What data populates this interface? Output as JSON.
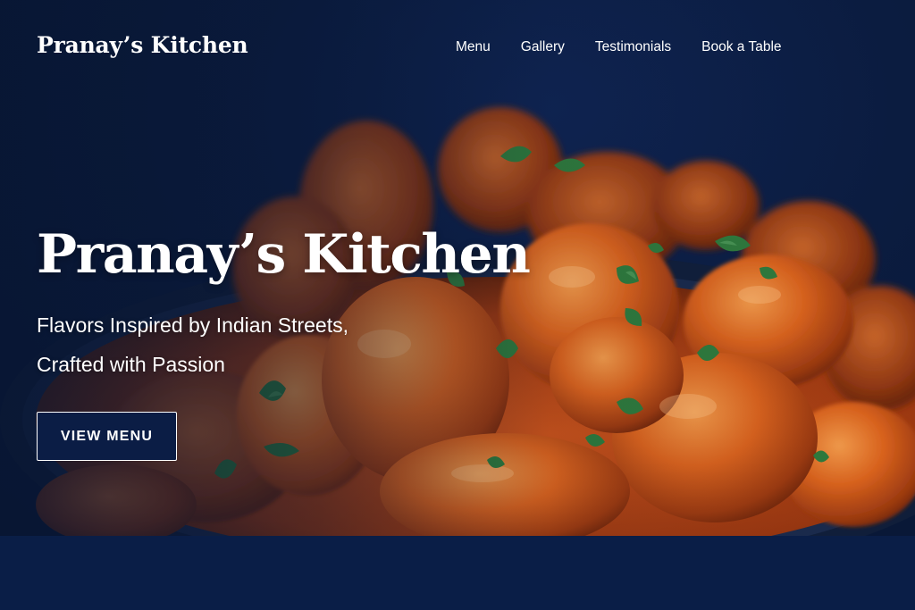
{
  "nav": {
    "brand": "Pranay’s Kitchen",
    "links": [
      "Menu",
      "Gallery",
      "Testimonials",
      "Book a Table"
    ]
  },
  "hero": {
    "title": "Pranay’s Kitchen",
    "tagline_line1": "Flavors Inspired by Indian Streets,",
    "tagline_line2": "Crafted with Passion",
    "cta_label": "VIEW MENU",
    "image": "butter-chicken-curry-photo"
  },
  "colors": {
    "navy": "#0a1e47",
    "text": "#ffffff",
    "curry": "#d4571c"
  }
}
